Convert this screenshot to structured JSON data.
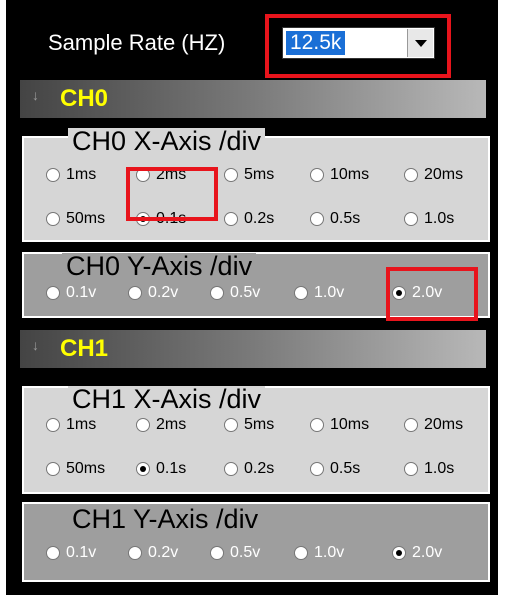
{
  "sample_rate": {
    "label": "Sample Rate (HZ)",
    "value": "12.5k"
  },
  "channels": [
    {
      "name": "CH0",
      "x_axis": {
        "title": "CH0 X-Axis /div",
        "options": [
          "1ms",
          "2ms",
          "5ms",
          "10ms",
          "20ms",
          "50ms",
          "0.1s",
          "0.2s",
          "0.5s",
          "1.0s"
        ],
        "selected": "0.1s"
      },
      "y_axis": {
        "title": "CH0 Y-Axis /div",
        "options": [
          "0.1v",
          "0.2v",
          "0.5v",
          "1.0v",
          "2.0v"
        ],
        "selected": "2.0v"
      }
    },
    {
      "name": "CH1",
      "x_axis": {
        "title": "CH1 X-Axis /div",
        "options": [
          "1ms",
          "2ms",
          "5ms",
          "10ms",
          "20ms",
          "50ms",
          "0.1s",
          "0.2s",
          "0.5s",
          "1.0s"
        ],
        "selected": "0.1s"
      },
      "y_axis": {
        "title": "CH1 Y-Axis /div",
        "options": [
          "0.1v",
          "0.2v",
          "0.5v",
          "1.0v",
          "2.0v"
        ],
        "selected": "2.0v"
      }
    }
  ],
  "highlight_color": "#e8141c",
  "icons": {
    "dropdown": "chevron-down-icon",
    "collapse": "double-chevron-icon"
  }
}
